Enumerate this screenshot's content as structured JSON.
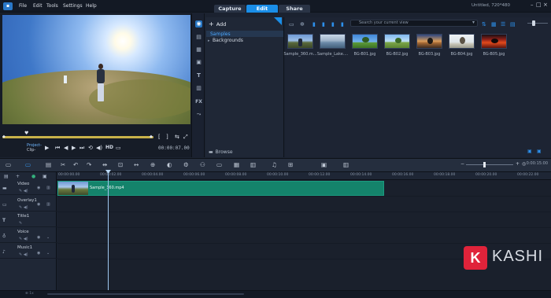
{
  "titlebar": {
    "menus": [
      "File",
      "Edit",
      "Tools",
      "Settings",
      "Help"
    ],
    "mode_tabs": [
      "Capture",
      "Edit",
      "Share"
    ],
    "active_tab": "Edit",
    "window_title": "Untitled, 720*480"
  },
  "preview": {
    "project_label": "Project-",
    "clip_label": "Clip-",
    "hd_label": "HD",
    "timecode": "00:00:07.00"
  },
  "library": {
    "add_label": "Add",
    "tree": [
      "Samples",
      "Backgrounds"
    ],
    "selected_folder": "Samples",
    "browse_label": "Browse",
    "search_placeholder": "Search your current view",
    "media": [
      {
        "name": "Sample_360.m...",
        "kind": "video360"
      },
      {
        "name": "Sample_Lake....",
        "kind": "lake"
      },
      {
        "name": "BG-B01.jpg",
        "kind": "tree-sky"
      },
      {
        "name": "BG-B02.jpg",
        "kind": "tree-field"
      },
      {
        "name": "BG-B03.jpg",
        "kind": "tree-dusk"
      },
      {
        "name": "BG-B04.jpg",
        "kind": "tree-light"
      },
      {
        "name": "BG-B05.jpg",
        "kind": "tree-red"
      }
    ]
  },
  "timeline": {
    "time_display": "0:00:15:00",
    "ruler": [
      "00:00:00.00",
      "00:00:02.00",
      "00:00:04.00",
      "00:00:06.00",
      "00:00:08.00",
      "00:00:10.00",
      "00:00:12.00",
      "00:00:14.00",
      "00:00:16.00",
      "00:00:18.00",
      "00:00:20.00",
      "00:00:22.00"
    ],
    "tracks": [
      {
        "name": "Video",
        "icon": "film-icon"
      },
      {
        "name": "Overlay1",
        "icon": "overlay-icon"
      },
      {
        "name": "Title1",
        "icon": "title-icon"
      },
      {
        "name": "Voice",
        "icon": "mic-icon"
      },
      {
        "name": "Music1",
        "icon": "music-icon"
      }
    ],
    "clip_name": "Sample_360.mp4"
  },
  "statusbar": {
    "label": "⊕ 1x"
  },
  "watermark": {
    "letter": "K",
    "text": "KASHI"
  },
  "colors": {
    "accent": "#1a8ee8",
    "clip": "#14836b",
    "watermark": "#e0233a"
  }
}
